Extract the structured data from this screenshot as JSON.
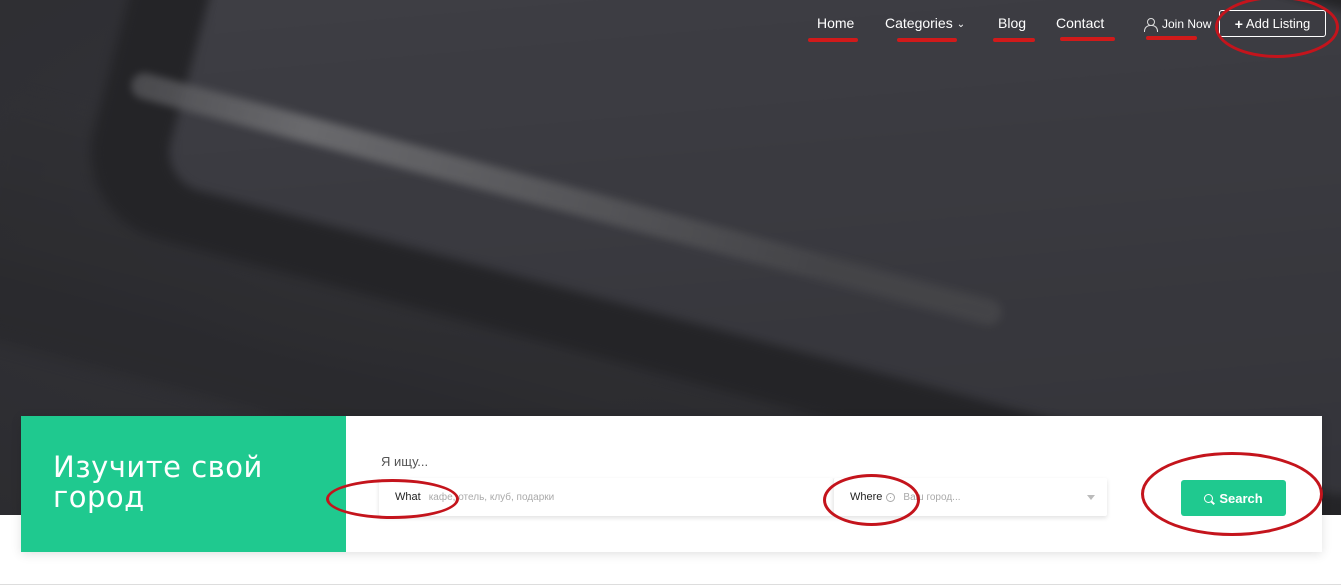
{
  "nav": {
    "items": [
      {
        "label": "Home"
      },
      {
        "label": "Categories",
        "chevron": "⌄"
      },
      {
        "label": "Blog"
      },
      {
        "label": "Contact"
      }
    ],
    "join_label": "Join Now",
    "add_listing_label": "Add Listing",
    "plus_icon": "+"
  },
  "search": {
    "title": "Изучите свой город",
    "seek_label": "Я ищу...",
    "what_label": "What",
    "what_placeholder": "кафе, отель, клуб, подарки",
    "where_label": "Where",
    "where_placeholder": "Ваш город...",
    "button_label": "Search"
  },
  "colors": {
    "accent": "#1fc98f",
    "annotation": "#c4141c"
  }
}
